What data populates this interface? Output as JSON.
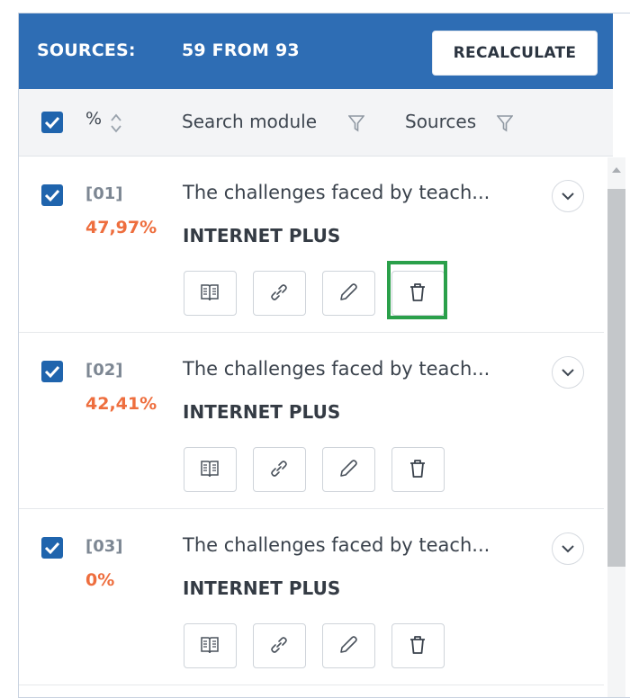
{
  "header": {
    "sources_label": "SOURCES:",
    "count_label": "59 FROM 93",
    "recalculate_label": "RECALCULATE"
  },
  "columns": {
    "percent": "%",
    "search_module": "Search module",
    "sources": "Sources"
  },
  "rows": [
    {
      "index": "[01]",
      "percent": "47,97%",
      "title": "The challenges faced by teach...",
      "module": "INTERNET PLUS",
      "checked": true
    },
    {
      "index": "[02]",
      "percent": "42,41%",
      "title": "The challenges faced by teach...",
      "module": "INTERNET PLUS",
      "checked": true
    },
    {
      "index": "[03]",
      "percent": "0%",
      "title": "The challenges faced by teach...",
      "module": "INTERNET PLUS",
      "checked": true
    }
  ],
  "actions": [
    "book-icon",
    "link-icon",
    "pencil-icon",
    "trash-icon"
  ],
  "colors": {
    "header_bg": "#2e6db4",
    "checkbox": "#1f64ad",
    "percent": "#ee6e3e",
    "highlight": "#2aa04a"
  }
}
